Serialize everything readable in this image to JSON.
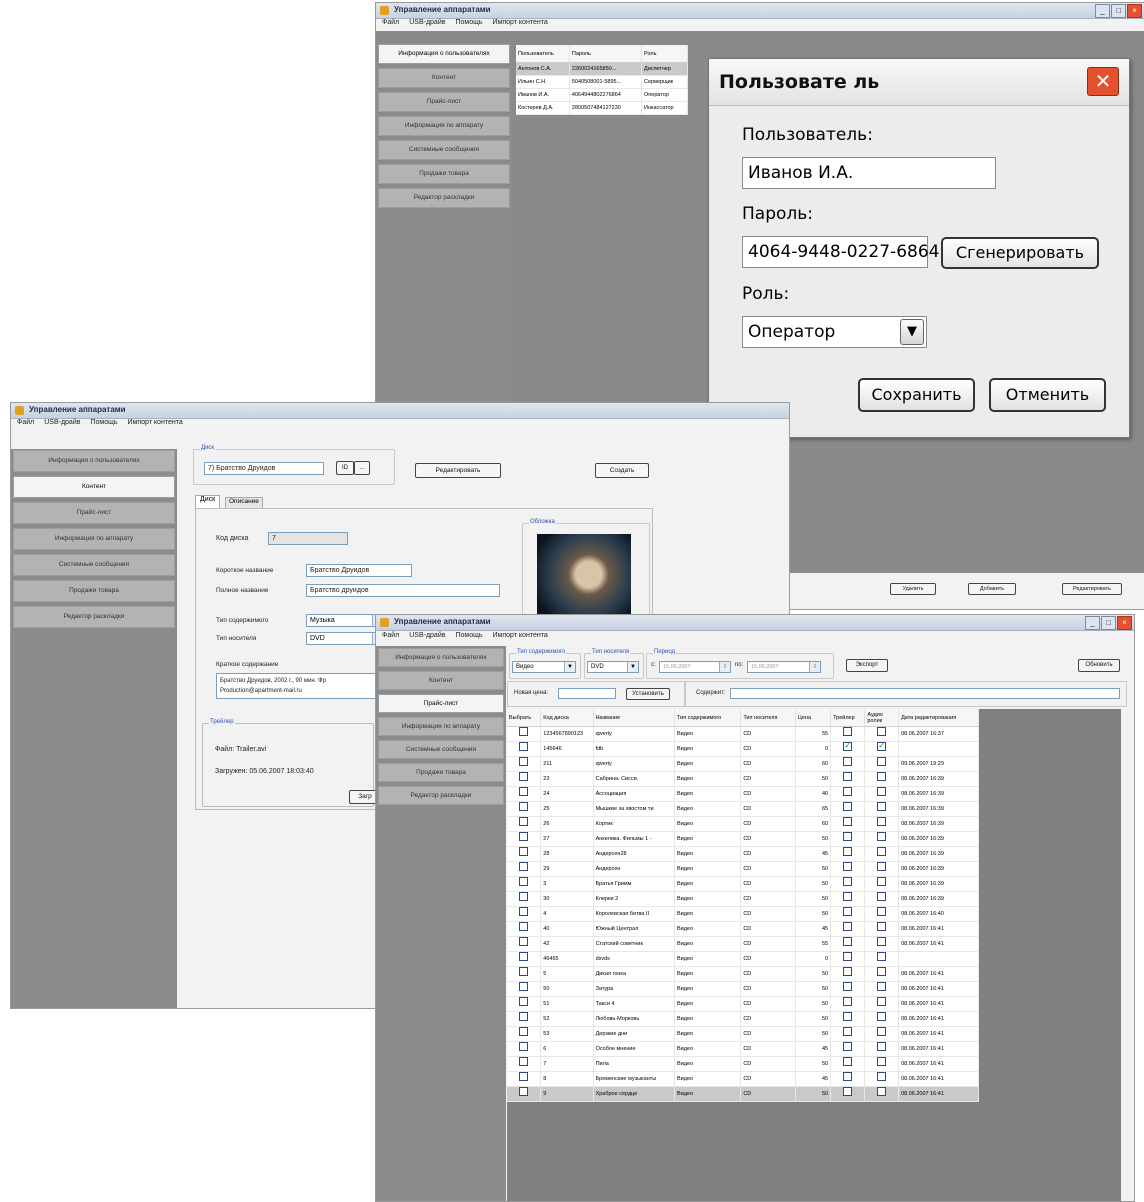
{
  "app": {
    "title": "Управление аппаратами",
    "menu": [
      "Файл",
      "USB-драйв",
      "Помощь",
      "Импорт контента"
    ],
    "sidebar": [
      "Информация о пользователях",
      "Контент",
      "Прайс-лист",
      "Информация по аппарату",
      "Системные сообщения",
      "Продажи товара",
      "Редактор раскладки"
    ]
  },
  "w1": {
    "users_table": {
      "headers": [
        "Пользователь",
        "Пароль",
        "Роль"
      ],
      "rows": [
        [
          "Антонов С.А.",
          "2260024165850...",
          "Диспетчер"
        ],
        [
          "Ильин С.Н.",
          "5040508001-5895...",
          "Серверщик"
        ],
        [
          "Иванов И.А.",
          "4064944802276864",
          "Оператор"
        ],
        [
          "Костерев Д.А.",
          "2800507484127230",
          "Инкассатор"
        ]
      ]
    },
    "bottom_buttons": [
      "Удалить",
      "Добавить",
      "Редактировать"
    ],
    "dialog": {
      "title": "Пользовате ль",
      "user_label": "Пользователь:",
      "user_value": "Иванов И.А.",
      "password_label": "Пароль:",
      "password_value": "4064-9448-0227-6864",
      "generate": "Сгенерировать",
      "role_label": "Роль:",
      "role_value": "Оператор",
      "save": "Сохранить",
      "cancel": "Отменить"
    }
  },
  "w2": {
    "disk_group": "Диск",
    "disk_value": "7) Братство Друидов",
    "edit_button": "Редактировать",
    "create_button": "Создать",
    "tabs": [
      "Диск",
      "Описание"
    ],
    "code_label": "Код диска",
    "code_value": "7",
    "short_name_label": "Короткое название",
    "short_name_value": "Братство Друидов",
    "full_name_label": "Полное название",
    "full_name_value": "Братство друидов",
    "content_type_label": "Тип содержимого",
    "content_type_value": "Музыка",
    "carrier_label": "Тип носителя",
    "carrier_value": "DVD",
    "summary_label": "Краткое содержание",
    "summary_line1": "Братство Друидов, 2002 г., 90 мин. Фр",
    "summary_line2": "Production@apartment-mail.ru",
    "cover_group": "Обложка",
    "trailer_group": "Трейлер",
    "file_label": "Файл: Trailer.avi",
    "uploaded_label": "Загружен: 05.06.2007 18:03:40",
    "load_button": "Загр"
  },
  "w3": {
    "filter_content_group": "Тип содержимого",
    "filter_content_value": "Видео",
    "filter_carrier_group": "Тип носителя",
    "filter_carrier_value": "DVD",
    "period_group": "Период",
    "from_label": "с:",
    "from_value": "15.06.2007",
    "to_label": "по:",
    "to_value": "15.06.2007",
    "export_button": "Экспорт",
    "refresh_button": "Обновить",
    "new_price_label": "Новая цена:",
    "set_button": "Установить",
    "contains_label": "Содержит:",
    "headers": [
      "Выбрать",
      "Код диска",
      "Название",
      "Тип содержимого",
      "Тип носителя",
      "Цена",
      "Трейлер",
      "Аудио ролик",
      "Дата редактирования"
    ],
    "rows": [
      {
        "code": "1234567890123",
        "name": "qwerty",
        "type": "Видео",
        "carrier": "CD",
        "price": "55",
        "trailer": false,
        "audio": false,
        "date": "08.06.2007 16:37"
      },
      {
        "code": "145646",
        "name": "fdb",
        "type": "Видео",
        "carrier": "CD",
        "price": "0",
        "trailer": true,
        "audio": true,
        "date": ""
      },
      {
        "code": "211",
        "name": "qwerty",
        "type": "Видео",
        "carrier": "CD",
        "price": "60",
        "trailer": false,
        "audio": false,
        "date": "09.06.2007 19:29"
      },
      {
        "code": "23",
        "name": "Сабрина. Сисси.",
        "type": "Видео",
        "carrier": "CD",
        "price": "50",
        "trailer": false,
        "audio": false,
        "date": "08.06.2007 16:39"
      },
      {
        "code": "24",
        "name": "Ассоциация",
        "type": "Видео",
        "carrier": "CD",
        "price": "40",
        "trailer": false,
        "audio": false,
        "date": "08.06.2007 16:39"
      },
      {
        "code": "25",
        "name": "Мышкие за хвостом ти",
        "type": "Видео",
        "carrier": "CD",
        "price": "65",
        "trailer": false,
        "audio": false,
        "date": "08.06.2007 16:39"
      },
      {
        "code": "26",
        "name": "Кортик",
        "type": "Видео",
        "carrier": "CD",
        "price": "60",
        "trailer": false,
        "audio": false,
        "date": "08.06.2007 16:39"
      },
      {
        "code": "27",
        "name": "Анкелика. Фильмы 1 -",
        "type": "Видео",
        "carrier": "CD",
        "price": "50",
        "trailer": false,
        "audio": false,
        "date": "08.06.2007 16:39"
      },
      {
        "code": "28",
        "name": "Андерсен28",
        "type": "Видео",
        "carrier": "CD",
        "price": "45",
        "trailer": false,
        "audio": false,
        "date": "08.06.2007 16:39"
      },
      {
        "code": "29",
        "name": "Андерсен",
        "type": "Видео",
        "carrier": "CD",
        "price": "50",
        "trailer": false,
        "audio": false,
        "date": "08.06.2007 16:39"
      },
      {
        "code": "3",
        "name": "Братья Гримм",
        "type": "Видео",
        "carrier": "CD",
        "price": "50",
        "trailer": false,
        "audio": false,
        "date": "08.06.2007 16:39"
      },
      {
        "code": "30",
        "name": "Клерки 2",
        "type": "Видео",
        "carrier": "CD",
        "price": "50",
        "trailer": false,
        "audio": false,
        "date": "08.06.2007 16:39"
      },
      {
        "code": "4",
        "name": "Королевская битва II",
        "type": "Видео",
        "carrier": "CD",
        "price": "50",
        "trailer": false,
        "audio": false,
        "date": "08.06.2007 16:40"
      },
      {
        "code": "40",
        "name": "Южный Централ",
        "type": "Видео",
        "carrier": "CD",
        "price": "45",
        "trailer": false,
        "audio": false,
        "date": "08.06.2007 16:41"
      },
      {
        "code": "42",
        "name": "Статский советник",
        "type": "Видео",
        "carrier": "CD",
        "price": "55",
        "trailer": false,
        "audio": false,
        "date": "08.06.2007 16:41"
      },
      {
        "code": "46465",
        "name": "dsvds",
        "type": "Видео",
        "carrier": "CD",
        "price": "0",
        "trailer": false,
        "audio": false,
        "date": ""
      },
      {
        "code": "5",
        "name": "Дикая гонка",
        "type": "Видео",
        "carrier": "CD",
        "price": "50",
        "trailer": false,
        "audio": false,
        "date": "08.06.2007 16:41"
      },
      {
        "code": "50",
        "name": "Затура",
        "type": "Видео",
        "carrier": "CD",
        "price": "50",
        "trailer": false,
        "audio": false,
        "date": "08.06.2007 16:41"
      },
      {
        "code": "51",
        "name": "Такси 4",
        "type": "Видео",
        "carrier": "CD",
        "price": "50",
        "trailer": false,
        "audio": false,
        "date": "08.06.2007 16:41"
      },
      {
        "code": "52",
        "name": "Любовь-Морковь",
        "type": "Видео",
        "carrier": "CD",
        "price": "50",
        "trailer": false,
        "audio": false,
        "date": "08.06.2007 16:41"
      },
      {
        "code": "53",
        "name": "Дерзкие дни",
        "type": "Видео",
        "carrier": "CD",
        "price": "50",
        "trailer": false,
        "audio": false,
        "date": "08.06.2007 16:41"
      },
      {
        "code": "6",
        "name": "Особое мнение",
        "type": "Видео",
        "carrier": "CD",
        "price": "45",
        "trailer": false,
        "audio": false,
        "date": "08.06.2007 16:41"
      },
      {
        "code": "7",
        "name": "Пила",
        "type": "Видео",
        "carrier": "CD",
        "price": "50",
        "trailer": false,
        "audio": false,
        "date": "08.06.2007 16:41"
      },
      {
        "code": "8",
        "name": "Бременские музыканты",
        "type": "Видео",
        "carrier": "CD",
        "price": "45",
        "trailer": false,
        "audio": false,
        "date": "08.06.2007 16:41"
      },
      {
        "code": "9",
        "name": "Храброе сердце",
        "type": "Видео",
        "carrier": "CD",
        "price": "50",
        "trailer": false,
        "audio": false,
        "date": "08.06.2007 16:41"
      }
    ]
  },
  "colors": {
    "sidebar": "#8c8c8c",
    "grid_bg": "#808080",
    "dialog_accent": "#e5502e"
  }
}
